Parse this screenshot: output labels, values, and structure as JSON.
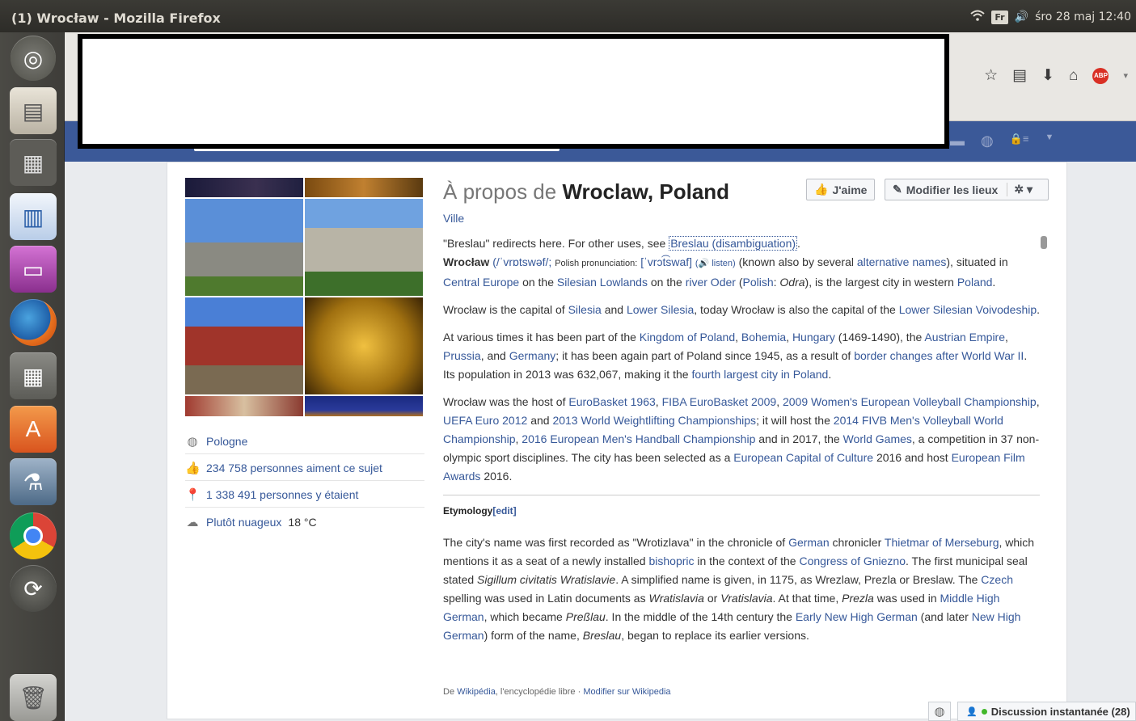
{
  "os": {
    "window_title": "(1) Wrocław - Mozilla Firefox",
    "keyboard_layout": "Fr",
    "clock": "śro 28 maj 12:40"
  },
  "page": {
    "title_prefix": "À propos de",
    "title_name": "Wroclaw, Poland",
    "category": "Ville",
    "like_label": "J'aime",
    "edit_label": "Modifier les lieux"
  },
  "sidebar_info": {
    "country": "Pologne",
    "likes": "234 758 personnes aiment ce sujet",
    "visits": "1 338 491 personnes y étaient",
    "weather_link": "Plutôt nuageux",
    "weather_temp": "18 °C"
  },
  "article": {
    "redirect": {
      "text": "\"Breslau\" redirects here. For other uses, see",
      "link": "Breslau (disambiguation)",
      "end": "."
    },
    "p1": {
      "name": "Wrocław",
      "ipa": "(/ˈvrɒtswəf/;",
      "polish_label": "Polish pronunciation:",
      "polish_ipa": "[ˈvrɔt͡swaf]",
      "listen": "(🔊 listen)",
      "t1": "(known also by several",
      "l_alt": "alternative names",
      "t2": "), situated in",
      "l_ce": "Central Europe",
      "t3": "on the",
      "l_sl": "Silesian Lowlands",
      "t4": "on the",
      "l_oder": "river Oder",
      "t5": "(",
      "l_polish": "Polish",
      "t6": ":",
      "odra": "Odra",
      "t7": "), is the largest city in western",
      "l_poland": "Poland",
      "t8": "."
    },
    "p2": {
      "t1": "Wrocław is the capital of",
      "l_sil": "Silesia",
      "t2": "and",
      "l_ls": "Lower Silesia",
      "t3": ", today Wrocław is also the capital of the",
      "l_lsv": "Lower Silesian Voivodeship",
      "t4": "."
    },
    "p3": {
      "t1": "At various times it has been part of the",
      "l_kp": "Kingdom of Poland",
      "c1": ",",
      "l_bo": "Bohemia",
      "c2": ",",
      "l_hu": "Hungary",
      "t2": "(1469-1490), the",
      "l_ae": "Austrian Empire",
      "c3": ",",
      "l_pr": "Prussia",
      "t3": ", and",
      "l_ge": "Germany",
      "t4": "; it has been again part of Poland since 1945, as a result of",
      "l_bc": "border changes after World War II",
      "t5": ". Its population in 2013 was 632,067, making it the",
      "l_fl": "fourth largest city in Poland",
      "t6": "."
    },
    "p4": {
      "t1": "Wrocław was the host of",
      "l_eb63": "EuroBasket 1963",
      "c1": ",",
      "l_eb09": "FIBA EuroBasket 2009",
      "c2": ",",
      "l_wvc": "2009 Women's European Volleyball Championship",
      "c3": ",",
      "l_euro": "UEFA Euro 2012",
      "t2": "and",
      "l_wwc": "2013 World Weightlifting Championships",
      "t3": "; it will host the",
      "l_fivb": "2014 FIVB Men's Volleyball World Championship",
      "c4": ",",
      "l_hand": "2016 European Men's Handball Championship",
      "t4": "and in 2017, the",
      "l_wg": "World Games",
      "t5": ", a competition in 37 non-olympic sport disciplines. The city has been selected as a",
      "l_ecc": "European Capital of Culture",
      "t6": "2016 and host",
      "l_efa": "European Film Awards",
      "t7": "2016."
    },
    "etym_heading": "Etymology",
    "etym_edit": "[edit]",
    "p5": {
      "t1": "The city's name was first recorded as \"Wrotizlava\" in the chronicle of",
      "l_german": "German",
      "t2": "chronicler",
      "l_thiet": "Thietmar of Merseburg",
      "t3": ", which mentions it as a seat of a newly installed",
      "l_bish": "bishopric",
      "t4": "in the context of the",
      "l_cong": "Congress of Gniezno",
      "t5": ". The first municipal seal stated",
      "seal": "Sigillum civitatis Wratislavie",
      "t6": ". A simplified name is given, in 1175, as Wrezlaw, Prezla or Breslaw. The",
      "l_czech": "Czech",
      "t7": "spelling was used in Latin documents as",
      "wrat": "Wratislavia",
      "t8": "or",
      "vrat": "Vratislavia",
      "t9": ". At that time,",
      "prezla": "Prezla",
      "t10": "was used in",
      "l_mhg": "Middle High German",
      "t11": ", which became",
      "pressla": "Preßlau",
      "t12": ". In the middle of the 14th century the",
      "l_enhg": "Early New High German",
      "t13": "(and later",
      "l_nhg": "New High German",
      "t14": ") form of the name,",
      "breslau": "Breslau",
      "t15": ", began to replace its earlier versions."
    }
  },
  "footer": {
    "prefix": "De",
    "wiki": "Wikipédia",
    "middle": ", l'encyclopédie libre ·",
    "edit_link": "Modifier sur Wikipedia"
  },
  "chat": {
    "label": "Discussion instantanée (28)"
  }
}
